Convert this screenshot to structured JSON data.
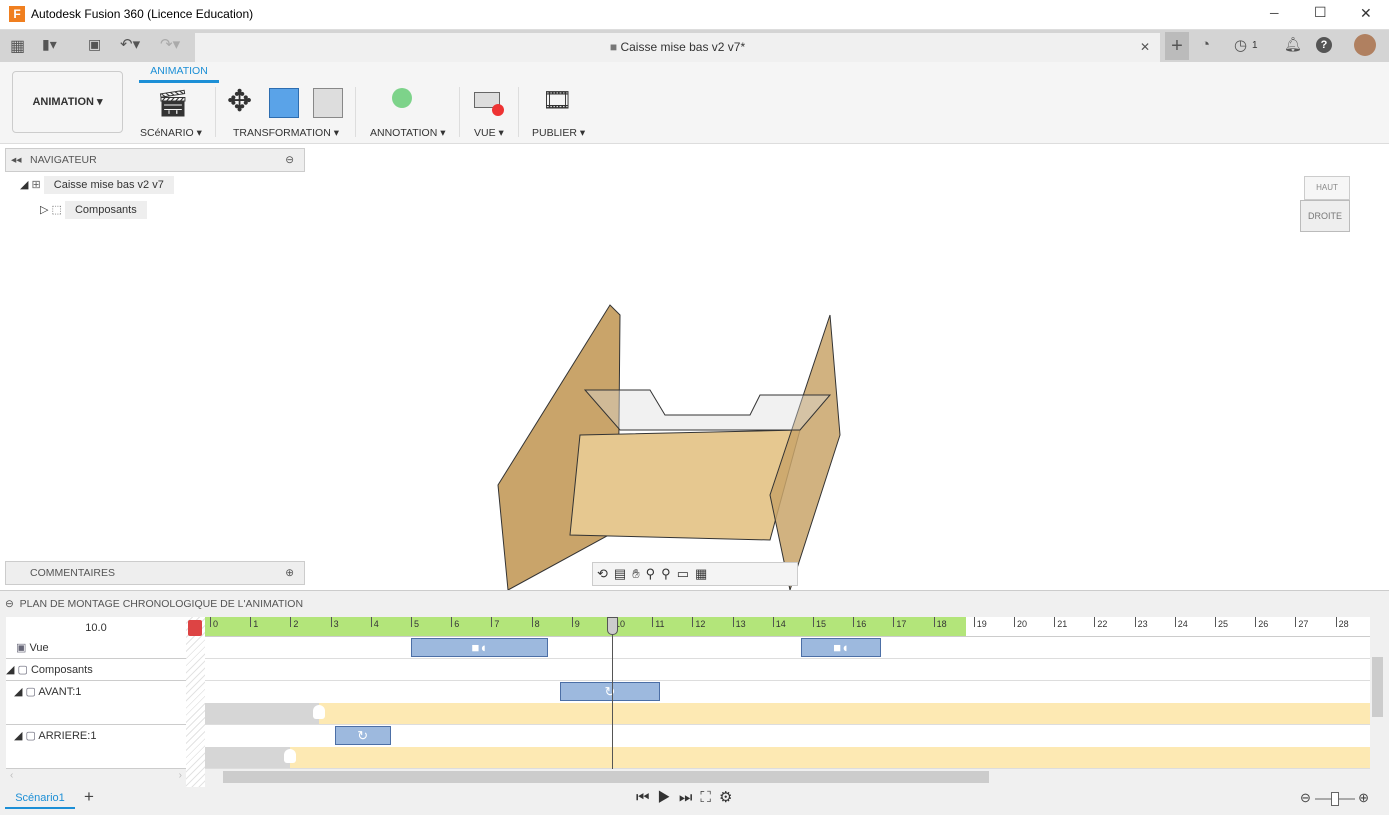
{
  "window": {
    "title": "Autodesk Fusion 360 (Licence Education)",
    "min": "─",
    "max": "☐",
    "close": "✕"
  },
  "tabbar": {
    "doc_title": "Caisse mise bas v2 v7*",
    "job_count": "1"
  },
  "ribbon": {
    "workspace": "ANIMATION",
    "active_tab": "ANIMATION",
    "groups": [
      "SCéNARIO",
      "TRANSFORMATION",
      "ANNOTATION",
      "VUE",
      "PUBLIER"
    ]
  },
  "navigator": {
    "title": "NAVIGATEUR",
    "root": "Caisse mise bas v2 v7",
    "child": "Composants"
  },
  "comments": {
    "title": "COMMENTAIRES"
  },
  "viewcube": {
    "face": "DROITE",
    "top": "HAUT"
  },
  "timeline": {
    "title": "PLAN DE MONTAGE CHRONOLOGIQUE DE L'ANIMATION",
    "current_time": "10.0",
    "playhead": 10.0,
    "green_end": 18.8,
    "ticks": [
      "0",
      "1",
      "2",
      "3",
      "4",
      "5",
      "6",
      "7",
      "8",
      "9",
      "10",
      "11",
      "12",
      "13",
      "14",
      "15",
      "16",
      "17",
      "18",
      "19",
      "20",
      "21",
      "22",
      "23",
      "24",
      "25",
      "26",
      "27",
      "28"
    ],
    "rows": [
      {
        "label": "Vue",
        "blocks": [
          {
            "start": 5.0,
            "end": 8.4,
            "icon": "camera-icon"
          },
          {
            "start": 14.7,
            "end": 16.7,
            "icon": "camera-icon"
          }
        ]
      },
      {
        "label": "Composants",
        "blocks": []
      },
      {
        "label": "AVANT:1",
        "blocks": [
          {
            "start": 8.7,
            "end": 11.2,
            "icon": "rotate-icon"
          }
        ],
        "visibility_start": 2.7
      },
      {
        "label": "ARRIERE:1",
        "blocks": [
          {
            "start": 3.1,
            "end": 4.5,
            "icon": "rotate-icon"
          }
        ],
        "visibility_start": 2.0
      }
    ],
    "colors": {
      "ruler": "#b3e57a",
      "block": "#9db9de",
      "visible": "#fde9b3",
      "hidden": "#d6d6d6"
    }
  },
  "footer": {
    "scenario_tab": "Scénario1",
    "add": "+"
  }
}
